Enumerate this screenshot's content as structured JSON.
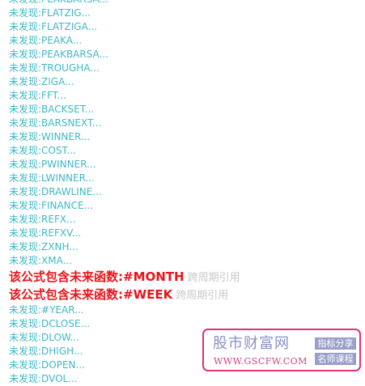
{
  "rows": [
    {
      "type": "ok",
      "text": "未发现:PEAKBARSA..."
    },
    {
      "type": "ok",
      "text": "未发现:FLATZIG..."
    },
    {
      "type": "ok",
      "text": "未发现:FLATZIGA..."
    },
    {
      "type": "ok",
      "text": "未发现:PEAKA..."
    },
    {
      "type": "ok",
      "text": "未发现:PEAKBARSA..."
    },
    {
      "type": "ok",
      "text": "未发现:TROUGHA..."
    },
    {
      "type": "ok",
      "text": "未发现:ZIGA..."
    },
    {
      "type": "ok",
      "text": "未发现:FFT..."
    },
    {
      "type": "ok",
      "text": "未发现:BACKSET..."
    },
    {
      "type": "ok",
      "text": "未发现:BARSNEXT..."
    },
    {
      "type": "ok",
      "text": "未发现:WINNER..."
    },
    {
      "type": "ok",
      "text": "未发现:COST..."
    },
    {
      "type": "ok",
      "text": "未发现:PWINNER..."
    },
    {
      "type": "ok",
      "text": "未发现:LWINNER..."
    },
    {
      "type": "ok",
      "text": "未发现:DRAWLINE..."
    },
    {
      "type": "ok",
      "text": "未发现:FINANCE..."
    },
    {
      "type": "ok",
      "text": "未发现:REFX..."
    },
    {
      "type": "ok",
      "text": "未发现:REFXV..."
    },
    {
      "type": "ok",
      "text": "未发现:ZXNH..."
    },
    {
      "type": "ok",
      "text": "未发现:XMA..."
    },
    {
      "type": "warn",
      "text": "该公式包含未来函数:#MONTH",
      "ref": "跨周期引用"
    },
    {
      "type": "warn",
      "text": "该公式包含未来函数:#WEEK",
      "ref": "跨周期引用"
    },
    {
      "type": "ok",
      "text": "未发现:#YEAR..."
    },
    {
      "type": "ok",
      "text": "未发现:DCLOSE..."
    },
    {
      "type": "ok",
      "text": "未发现:DLOW..."
    },
    {
      "type": "ok",
      "text": "未发现:DHIGH..."
    },
    {
      "type": "ok",
      "text": "未发现:DOPEN..."
    },
    {
      "type": "ok",
      "text": "未发现:DVOL..."
    }
  ],
  "watermark": {
    "brand": "股市财富网",
    "url": "WWW.GSCFW.COM",
    "tag_indicator": "指标分享",
    "tag_course": "名师课程"
  },
  "colors": {
    "found_none": "#3fb8c6",
    "future_warning": "#e8141b",
    "cross_period_ref": "#c8c8c8",
    "watermark_border": "#e0307a"
  }
}
